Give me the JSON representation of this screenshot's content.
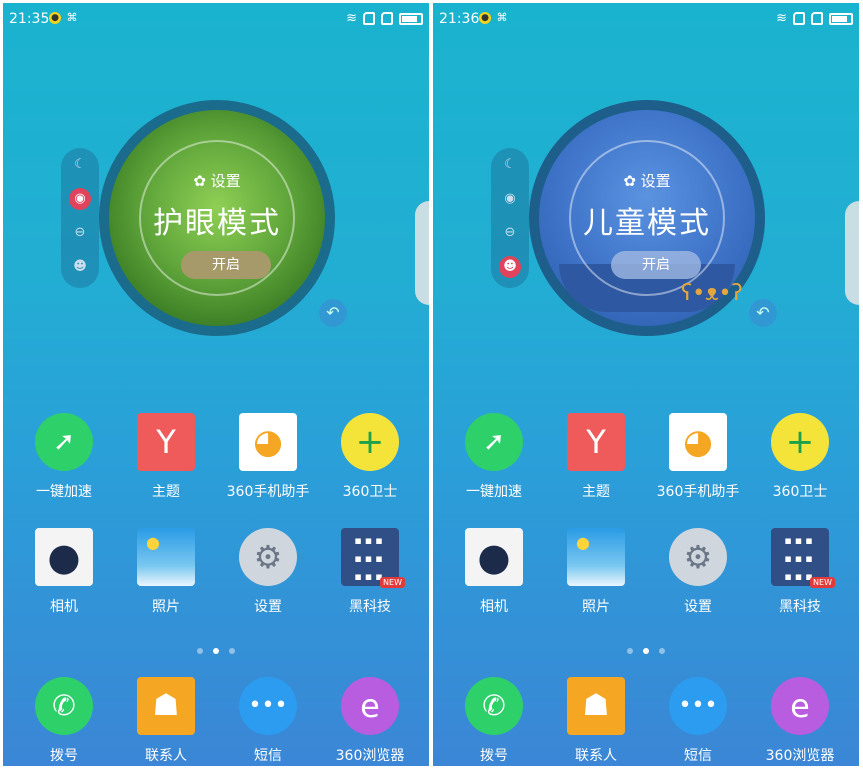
{
  "left": {
    "status": {
      "time": "21:35"
    },
    "mode": {
      "settings_label": "设置",
      "title": "护眼模式",
      "button": "开启"
    },
    "apps": [
      {
        "label": "一键加速",
        "icon": "speed-icon"
      },
      {
        "label": "主题",
        "icon": "theme-icon"
      },
      {
        "label": "360手机助手",
        "icon": "app-store-icon"
      },
      {
        "label": "360卫士",
        "icon": "security-icon"
      },
      {
        "label": "相机",
        "icon": "camera-icon"
      },
      {
        "label": "照片",
        "icon": "photos-icon"
      },
      {
        "label": "设置",
        "icon": "settings-icon"
      },
      {
        "label": "黑科技",
        "icon": "black-tech-icon",
        "badge": "NEW"
      }
    ],
    "dock": [
      {
        "label": "拨号",
        "icon": "phone-icon"
      },
      {
        "label": "联系人",
        "icon": "contacts-icon"
      },
      {
        "label": "短信",
        "icon": "messages-icon"
      },
      {
        "label": "360浏览器",
        "icon": "browser-icon"
      }
    ]
  },
  "right": {
    "status": {
      "time": "21:36"
    },
    "mode": {
      "settings_label": "设置",
      "title": "儿童模式",
      "button": "开启"
    },
    "apps": [
      {
        "label": "一键加速",
        "icon": "speed-icon"
      },
      {
        "label": "主题",
        "icon": "theme-icon"
      },
      {
        "label": "360手机助手",
        "icon": "app-store-icon"
      },
      {
        "label": "360卫士",
        "icon": "security-icon"
      },
      {
        "label": "相机",
        "icon": "camera-icon"
      },
      {
        "label": "照片",
        "icon": "photos-icon"
      },
      {
        "label": "设置",
        "icon": "settings-icon"
      },
      {
        "label": "黑科技",
        "icon": "black-tech-icon",
        "badge": "NEW"
      }
    ],
    "dock": [
      {
        "label": "拨号",
        "icon": "phone-icon"
      },
      {
        "label": "联系人",
        "icon": "contacts-icon"
      },
      {
        "label": "短信",
        "icon": "messages-icon"
      },
      {
        "label": "360浏览器",
        "icon": "browser-icon"
      }
    ]
  },
  "pages": {
    "count": 3,
    "current": 2
  },
  "colors": {
    "eye_mode_green": "#5fa53a",
    "kid_mode_blue": "#3d72c7",
    "active_red": "#e0435b"
  }
}
